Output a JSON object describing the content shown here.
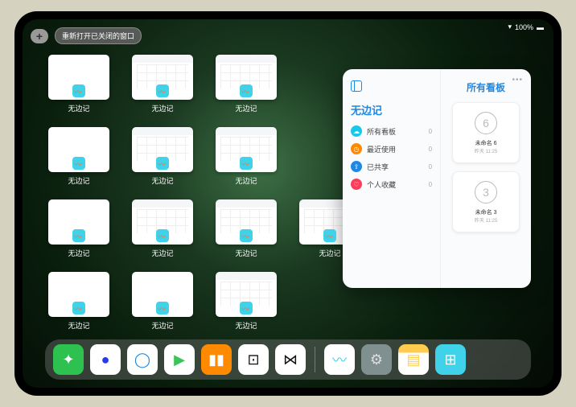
{
  "statusbar": {
    "battery": "100%"
  },
  "topbar": {
    "reopen_label": "重新打开已关闭的窗口"
  },
  "card_label": "无边记",
  "cards": [
    {
      "style": "blank"
    },
    {
      "style": "grid"
    },
    {
      "style": "grid"
    },
    null,
    {
      "style": "blank"
    },
    {
      "style": "grid"
    },
    {
      "style": "grid"
    },
    null,
    {
      "style": "blank"
    },
    {
      "style": "grid"
    },
    {
      "style": "grid"
    },
    {
      "style": "grid"
    },
    {
      "style": "blank"
    },
    {
      "style": "blank"
    },
    {
      "style": "grid"
    },
    null
  ],
  "panel": {
    "left_title": "无边记",
    "right_title": "所有看板",
    "menu": [
      {
        "icon": "cloud",
        "label": "所有看板",
        "count": "0"
      },
      {
        "icon": "clock",
        "label": "最近使用",
        "count": "0"
      },
      {
        "icon": "share",
        "label": "已共享",
        "count": "0"
      },
      {
        "icon": "fav",
        "label": "个人收藏",
        "count": "0"
      }
    ],
    "boards": [
      {
        "digit": "6",
        "name": "未命名 6",
        "sub": "昨天 11:25"
      },
      {
        "digit": "3",
        "name": "未命名 3",
        "sub": "昨天 11:25"
      }
    ]
  },
  "dock": [
    {
      "name": "wechat",
      "bg": "#2dc150",
      "glyph": "✦",
      "color": "#fff"
    },
    {
      "name": "browser",
      "bg": "#fff",
      "glyph": "●",
      "color": "#2a3ae8"
    },
    {
      "name": "qqbrowser",
      "bg": "#fff",
      "glyph": "◯",
      "color": "#1e88e5"
    },
    {
      "name": "play",
      "bg": "#fff",
      "glyph": "▶",
      "color": "#3ac55a"
    },
    {
      "name": "books",
      "bg": "#ff8a00",
      "glyph": "▮▮",
      "color": "#fff"
    },
    {
      "name": "game",
      "bg": "#fff",
      "glyph": "⊡",
      "color": "#111"
    },
    {
      "name": "connect",
      "bg": "#fff",
      "glyph": "⋈",
      "color": "#111"
    },
    {
      "name": "freeform",
      "bg": "#fff",
      "glyph": "〰",
      "color": "#3fd2e8"
    },
    {
      "name": "settings",
      "bg": "#809090",
      "glyph": "⚙",
      "color": "#ddd"
    },
    {
      "name": "notes",
      "bg": "#fff",
      "glyph": "▤",
      "color": "#ffcc4d",
      "topbar": "#ffcc4d"
    },
    {
      "name": "apps",
      "bg": "#3fd2e8",
      "glyph": "⊞",
      "color": "#fff"
    }
  ]
}
